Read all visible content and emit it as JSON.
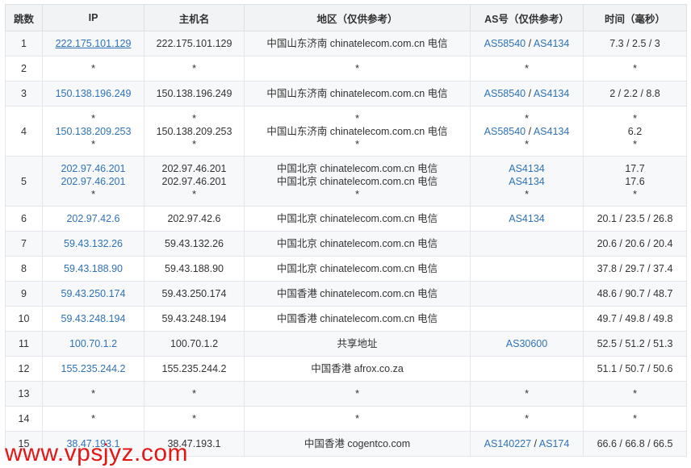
{
  "headers": {
    "hop": "跳数",
    "ip": "IP",
    "hostname": "主机名",
    "region": "地区（仅供参考）",
    "asn": "AS号（仅供参考）",
    "time": "时间（毫秒）"
  },
  "rows": [
    {
      "hop": "1",
      "ip": [
        "222.175.101.129"
      ],
      "host": [
        "222.175.101.129"
      ],
      "region": [
        "中国山东济南 chinatelecom.com.cn 电信"
      ],
      "asn": [
        [
          "AS58540",
          "AS4134"
        ]
      ],
      "time": [
        "7.3 / 2.5 / 3"
      ]
    },
    {
      "hop": "2",
      "ip": [
        "*"
      ],
      "host": [
        "*"
      ],
      "region": [
        "*"
      ],
      "asn": [
        [
          "*"
        ]
      ],
      "time": [
        "*"
      ]
    },
    {
      "hop": "3",
      "ip": [
        "150.138.196.249"
      ],
      "host": [
        "150.138.196.249"
      ],
      "region": [
        "中国山东济南 chinatelecom.com.cn 电信"
      ],
      "asn": [
        [
          "AS58540",
          "AS4134"
        ]
      ],
      "time": [
        "2 / 2.2 / 8.8"
      ]
    },
    {
      "hop": "4",
      "ip": [
        "*",
        "150.138.209.253",
        "*"
      ],
      "host": [
        "*",
        "150.138.209.253",
        "*"
      ],
      "region": [
        "*",
        "中国山东济南 chinatelecom.com.cn 电信",
        "*"
      ],
      "asn": [
        [
          "*"
        ],
        [
          "AS58540",
          "AS4134"
        ],
        [
          "*"
        ]
      ],
      "time": [
        "*",
        "6.2",
        "*"
      ]
    },
    {
      "hop": "5",
      "ip": [
        "202.97.46.201",
        "202.97.46.201",
        "*"
      ],
      "host": [
        "202.97.46.201",
        "202.97.46.201",
        "*"
      ],
      "region": [
        "中国北京 chinatelecom.com.cn 电信",
        "中国北京 chinatelecom.com.cn 电信",
        "*"
      ],
      "asn": [
        [
          "AS4134"
        ],
        [
          "AS4134"
        ],
        [
          "*"
        ]
      ],
      "time": [
        "17.7",
        "17.6",
        "*"
      ]
    },
    {
      "hop": "6",
      "ip": [
        "202.97.42.6"
      ],
      "host": [
        "202.97.42.6"
      ],
      "region": [
        "中国北京 chinatelecom.com.cn 电信"
      ],
      "asn": [
        [
          "AS4134"
        ]
      ],
      "time": [
        "20.1 / 23.5 / 26.8"
      ]
    },
    {
      "hop": "7",
      "ip": [
        "59.43.132.26"
      ],
      "host": [
        "59.43.132.26"
      ],
      "region": [
        "中国北京 chinatelecom.com.cn 电信"
      ],
      "asn": [],
      "time": [
        "20.6 / 20.6 / 20.4"
      ]
    },
    {
      "hop": "8",
      "ip": [
        "59.43.188.90"
      ],
      "host": [
        "59.43.188.90"
      ],
      "region": [
        "中国北京 chinatelecom.com.cn 电信"
      ],
      "asn": [],
      "time": [
        "37.8 / 29.7 / 37.4"
      ]
    },
    {
      "hop": "9",
      "ip": [
        "59.43.250.174"
      ],
      "host": [
        "59.43.250.174"
      ],
      "region": [
        "中国香港 chinatelecom.com.cn 电信"
      ],
      "asn": [],
      "time": [
        "48.6 / 90.7 / 48.7"
      ]
    },
    {
      "hop": "10",
      "ip": [
        "59.43.248.194"
      ],
      "host": [
        "59.43.248.194"
      ],
      "region": [
        "中国香港 chinatelecom.com.cn 电信"
      ],
      "asn": [],
      "time": [
        "49.7 / 49.8 / 49.8"
      ]
    },
    {
      "hop": "11",
      "ip": [
        "100.70.1.2"
      ],
      "host": [
        "100.70.1.2"
      ],
      "region": [
        "共享地址"
      ],
      "asn": [
        [
          "AS30600"
        ]
      ],
      "time": [
        "52.5 / 51.2 / 51.3"
      ]
    },
    {
      "hop": "12",
      "ip": [
        "155.235.244.2"
      ],
      "host": [
        "155.235.244.2"
      ],
      "region": [
        "中国香港 afrox.co.za"
      ],
      "asn": [],
      "time": [
        "51.1 / 50.7 / 50.6"
      ]
    },
    {
      "hop": "13",
      "ip": [
        "*"
      ],
      "host": [
        "*"
      ],
      "region": [
        "*"
      ],
      "asn": [
        [
          "*"
        ]
      ],
      "time": [
        "*"
      ]
    },
    {
      "hop": "14",
      "ip": [
        "*"
      ],
      "host": [
        "*"
      ],
      "region": [
        "*"
      ],
      "asn": [
        [
          "*"
        ]
      ],
      "time": [
        "*"
      ]
    },
    {
      "hop": "15",
      "ip": [
        "38.47.193.1"
      ],
      "host": [
        "38.47.193.1"
      ],
      "region": [
        "中国香港 cogentco.com"
      ],
      "asn": [
        [
          "AS140227",
          "AS174"
        ]
      ],
      "time": [
        "66.6 / 66.8 / 66.5"
      ]
    }
  ],
  "watermark": "www.vpsjyz.com",
  "colors": {
    "link": "#2f72b7",
    "watermark": "#e01818",
    "header_bg": "#f2f3f5"
  }
}
